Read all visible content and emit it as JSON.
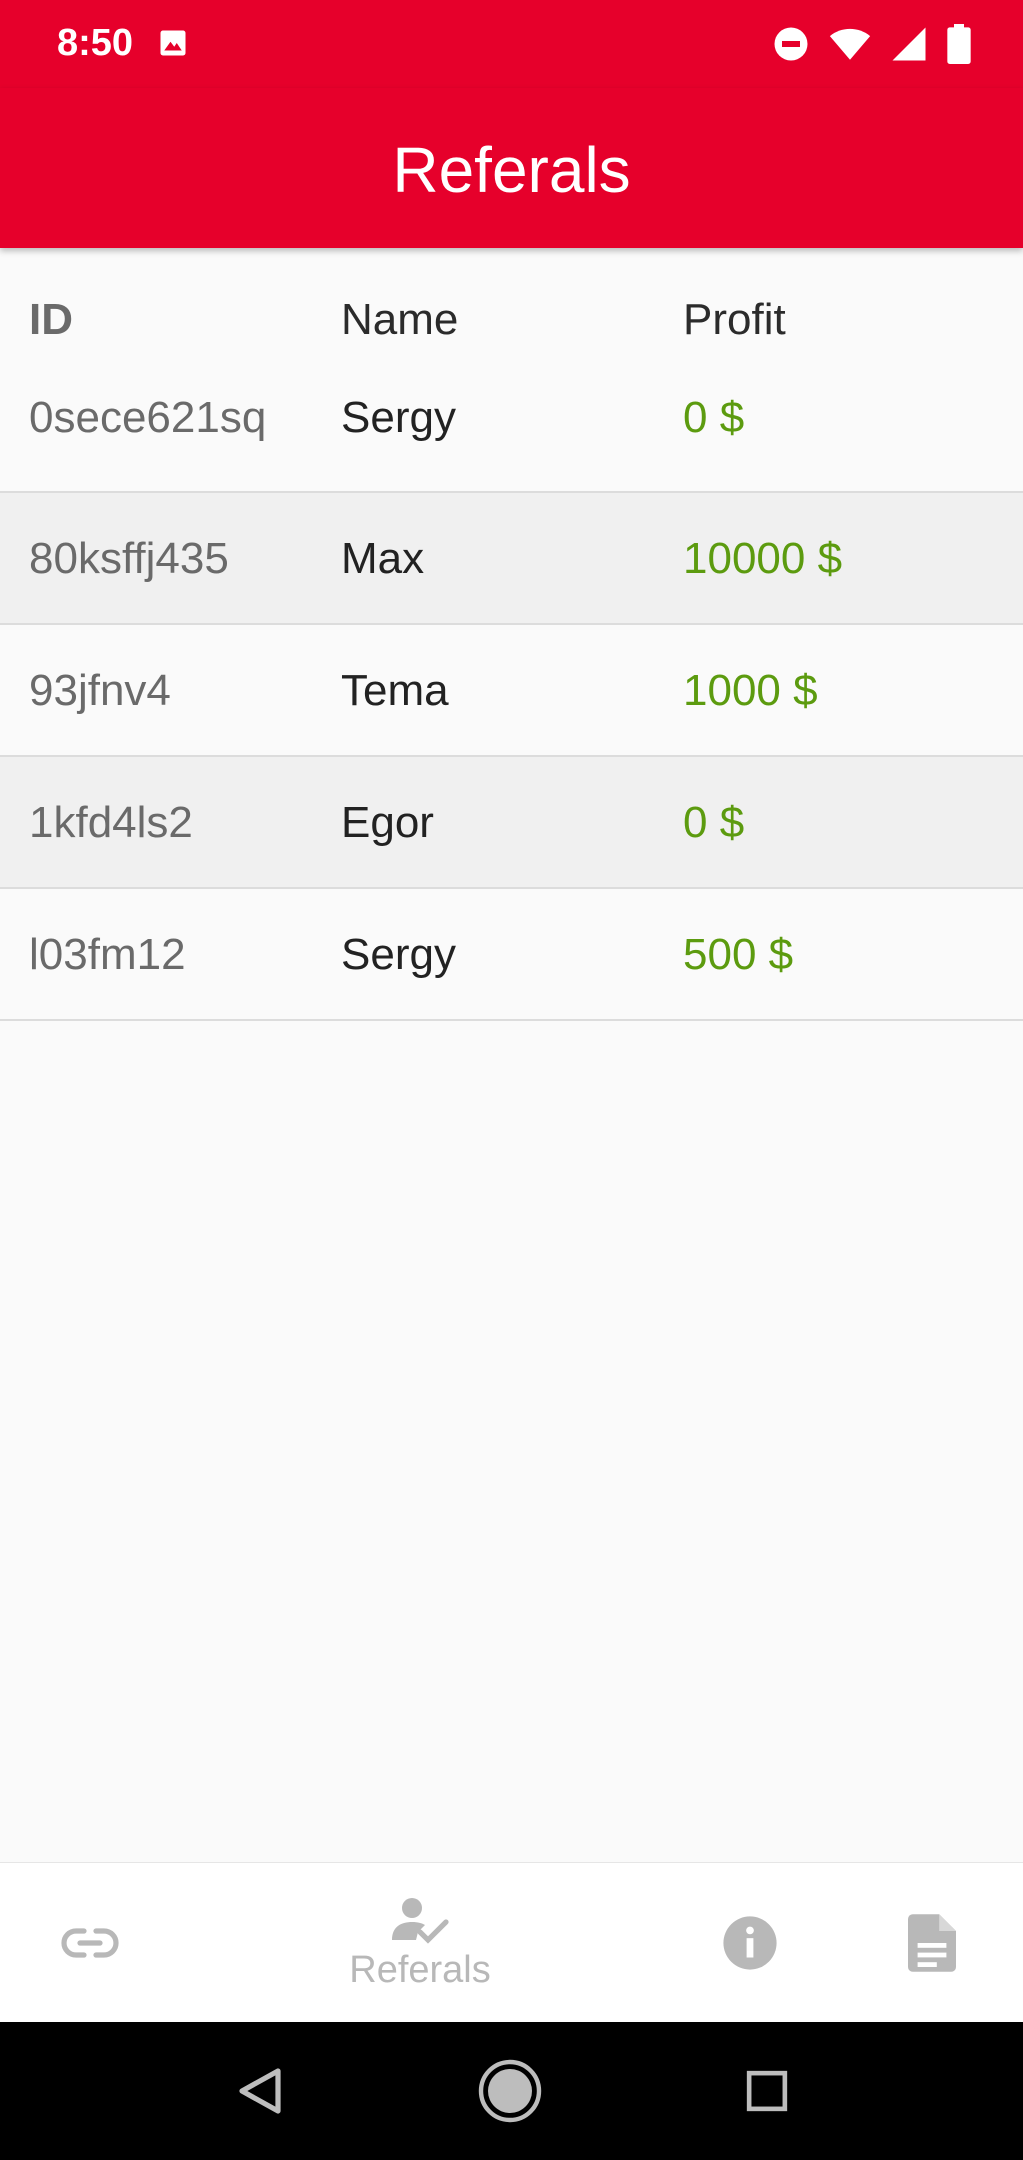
{
  "status_bar": {
    "time": "8:50"
  },
  "app_bar": {
    "title": "Referals"
  },
  "table": {
    "headers": [
      "ID",
      "Name",
      "Profit"
    ],
    "rows": [
      {
        "id": "0sece621sq",
        "name": "Sergy",
        "profit": "0 $"
      },
      {
        "id": "80ksffj435",
        "name": "Max",
        "profit": "10000 $"
      },
      {
        "id": "93jfnv4",
        "name": "Tema",
        "profit": "1000 $"
      },
      {
        "id": "1kfd4ls2",
        "name": "Egor",
        "profit": "0 $"
      },
      {
        "id": "l03fm12",
        "name": "Sergy",
        "profit": "500 $"
      }
    ]
  },
  "bottom_nav": {
    "items": [
      {
        "icon": "link-icon",
        "label": ""
      },
      {
        "icon": "person-check-icon",
        "label": "Referals"
      },
      {
        "icon": "info-icon",
        "label": ""
      },
      {
        "icon": "document-icon",
        "label": ""
      }
    ]
  },
  "colors": {
    "accent": "#e6002b",
    "profit": "#5c9b0f",
    "nav_inactive": "#b8b8b8"
  }
}
